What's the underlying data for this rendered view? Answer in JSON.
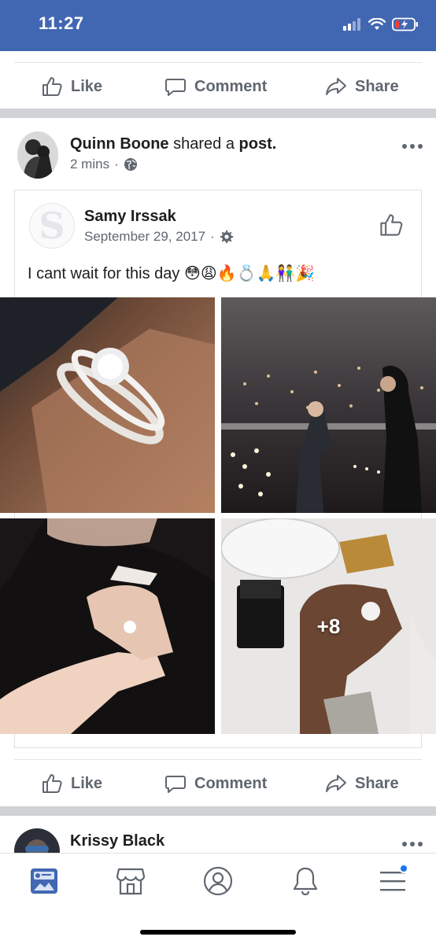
{
  "status_bar": {
    "time": "11:27",
    "icons": [
      "signal-icon",
      "wifi-icon",
      "battery-charging-icon"
    ]
  },
  "top_actions": {
    "like": "Like",
    "comment": "Comment",
    "share": "Share"
  },
  "post": {
    "author": "Quinn Boone",
    "action_text": "shared a",
    "action_target": "post.",
    "time": "2 mins",
    "privacy_icon": "globe-icon",
    "shared": {
      "author": "Samy Irssak",
      "logo_letter": "S",
      "date": "September 29, 2017",
      "privacy_icon": "gear-icon",
      "text": "I cant wait for this day 😳😩🔥💍🙏👫🎉",
      "photos": [
        {
          "label": "engagement ring in box"
        },
        {
          "label": "proposal on rooftop at night"
        },
        {
          "label": "hand with ring"
        },
        {
          "label": "holding hands with ring box",
          "more_count": "+8"
        }
      ]
    },
    "actions": {
      "like": "Like",
      "comment": "Comment",
      "share": "Share"
    }
  },
  "next_post": {
    "author": "Krissy Black"
  },
  "bottom_nav": {
    "items": [
      "news-feed-icon",
      "marketplace-icon",
      "profile-icon",
      "notifications-icon",
      "menu-icon"
    ],
    "accent": "#1877f2"
  },
  "colors": {
    "brand": "#4267b2",
    "text": "#1c1e21",
    "secondary": "#606770",
    "separator": "#d0d2d6"
  }
}
